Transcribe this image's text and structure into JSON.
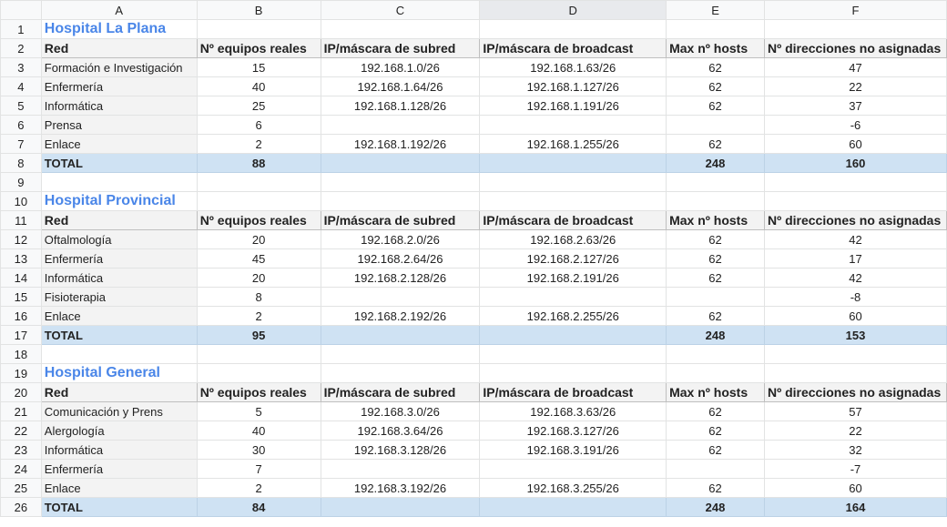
{
  "columns": [
    "A",
    "B",
    "C",
    "D",
    "E",
    "F"
  ],
  "sections": [
    {
      "title": "Hospital La Plana",
      "headers": [
        "Red",
        "Nº equipos reales",
        "IP/máscara de subred",
        "IP/máscara de broadcast",
        "Max nº hosts",
        "Nº direcciones no asignadas"
      ],
      "rows": [
        [
          "Formación e Investigación",
          "15",
          "192.168.1.0/26",
          "192.168.1.63/26",
          "62",
          "47"
        ],
        [
          "Enfermería",
          "40",
          "192.168.1.64/26",
          "192.168.1.127/26",
          "62",
          "22"
        ],
        [
          "Informática",
          "25",
          "192.168.1.128/26",
          "192.168.1.191/26",
          "62",
          "37"
        ],
        [
          "Prensa",
          "6",
          "",
          "",
          "",
          "-6"
        ],
        [
          "Enlace",
          "2",
          "192.168.1.192/26",
          "192.168.1.255/26",
          "62",
          "60"
        ]
      ],
      "total": [
        "TOTAL",
        "88",
        "",
        "",
        "248",
        "160"
      ]
    },
    {
      "title": "Hospital Provincial",
      "headers": [
        "Red",
        "Nº equipos reales",
        "IP/máscara de subred",
        "IP/máscara de broadcast",
        "Max nº hosts",
        "Nº direcciones no asignadas"
      ],
      "rows": [
        [
          "Oftalmología",
          "20",
          "192.168.2.0/26",
          "192.168.2.63/26",
          "62",
          "42"
        ],
        [
          "Enfermería",
          "45",
          "192.168.2.64/26",
          "192.168.2.127/26",
          "62",
          "17"
        ],
        [
          "Informática",
          "20",
          "192.168.2.128/26",
          "192.168.2.191/26",
          "62",
          "42"
        ],
        [
          "Fisioterapia",
          "8",
          "",
          "",
          "",
          "-8"
        ],
        [
          "Enlace",
          "2",
          "192.168.2.192/26",
          "192.168.2.255/26",
          "62",
          "60"
        ]
      ],
      "total": [
        "TOTAL",
        "95",
        "",
        "",
        "248",
        "153"
      ]
    },
    {
      "title": "Hospital General",
      "headers": [
        "Red",
        "Nº equipos reales",
        "IP/máscara de subred",
        "IP/máscara de broadcast",
        "Max nº hosts",
        "Nº direcciones no asignadas"
      ],
      "rows": [
        [
          "Comunicación y Prens",
          "5",
          "192.168.3.0/26",
          "192.168.3.63/26",
          "62",
          "57"
        ],
        [
          "Alergología",
          "40",
          "192.168.3.64/26",
          "192.168.3.127/26",
          "62",
          "22"
        ],
        [
          "Informática",
          "30",
          "192.168.3.128/26",
          "192.168.3.191/26",
          "62",
          "32"
        ],
        [
          "Enfermería",
          "7",
          "",
          "",
          "",
          "-7"
        ],
        [
          "Enlace",
          "2",
          "192.168.3.192/26",
          "192.168.3.255/26",
          "62",
          "60"
        ]
      ],
      "total": [
        "TOTAL",
        "84",
        "",
        "",
        "248",
        "164"
      ]
    }
  ]
}
